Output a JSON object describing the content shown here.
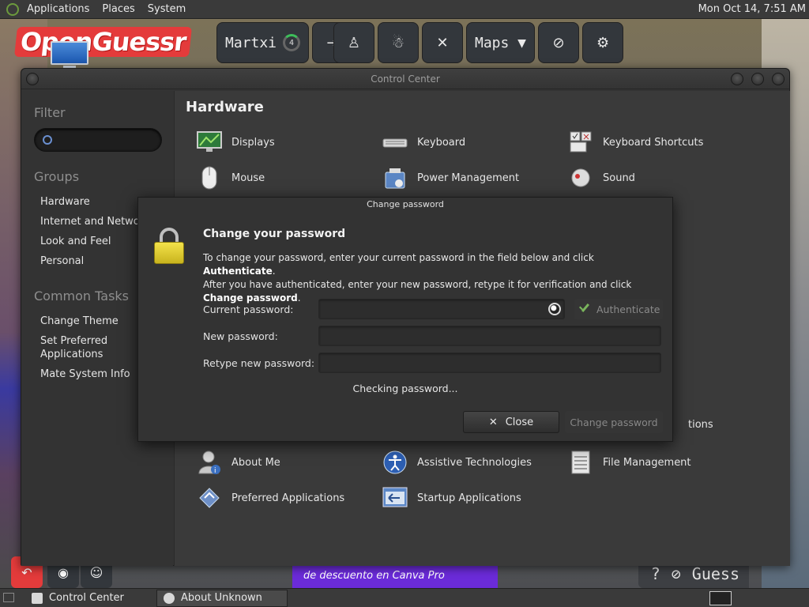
{
  "top_panel": {
    "menu": [
      "Applications",
      "Places",
      "System"
    ],
    "clock": "Mon Oct 14,  7:51 AM"
  },
  "game": {
    "logo": "OpenGuessr",
    "user_name": "Martxi",
    "level": "4",
    "maps_label": "Maps ▼",
    "ad_text": "de descuento en Canva Pro",
    "guess_label": "Guess",
    "help_glyph": "?"
  },
  "control_center": {
    "title": "Control Center",
    "sidebar": {
      "filter_label": "Filter",
      "groups_label": "Groups",
      "groups": [
        "Hardware",
        "Internet and Network",
        "Look and Feel",
        "Personal"
      ],
      "common_tasks_label": "Common Tasks",
      "tasks": [
        "Change Theme",
        "Set Preferred Applications",
        "Mate System Info"
      ]
    },
    "section_title": "Hardware",
    "applets": [
      {
        "label": "Displays",
        "icon": "display-icon"
      },
      {
        "label": "Keyboard",
        "icon": "keyboard-icon"
      },
      {
        "label": "Keyboard Shortcuts",
        "icon": "keyboard-shortcuts-icon"
      },
      {
        "label": "Mouse",
        "icon": "mouse-icon"
      },
      {
        "label": "Power Management",
        "icon": "power-management-icon"
      },
      {
        "label": "Sound",
        "icon": "sound-icon"
      },
      {
        "label": "About Me",
        "icon": "about-me-icon"
      },
      {
        "label": "Assistive Technologies",
        "icon": "accessibility-icon"
      },
      {
        "label": "File Management",
        "icon": "file-management-icon"
      },
      {
        "label": "Preferred Applications",
        "icon": "preferred-apps-icon"
      },
      {
        "label": "Startup Applications",
        "icon": "startup-apps-icon"
      }
    ],
    "partial_label": "tions"
  },
  "dialog": {
    "title": "Change password",
    "heading": "Change your password",
    "desc_1": "To change your password, enter your current password in the field below and click ",
    "desc_1_bold": "Authenticate",
    "desc_1_end": ".",
    "desc_2": "After you have authenticated, enter your new password, retype it for verification and click ",
    "desc_2_bold": "Change password",
    "desc_2_end": ".",
    "current_label": "Current password:",
    "new_label": "New password:",
    "retype_label": "Retype new password:",
    "authenticate_label": "Authenticate",
    "status": "Checking password...",
    "close_label": "Close",
    "change_label": "Change password"
  },
  "taskbar": {
    "tasks": [
      {
        "label": "Control Center",
        "active": false
      },
      {
        "label": "About Unknown",
        "active": true
      }
    ]
  }
}
